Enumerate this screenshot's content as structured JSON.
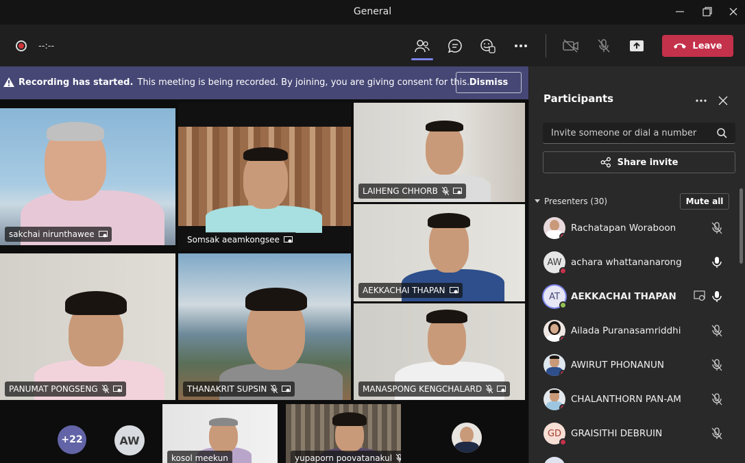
{
  "window": {
    "title": "General"
  },
  "toolbar": {
    "timer": "--:--",
    "leave_label": "Leave"
  },
  "banner": {
    "title": "Recording has started.",
    "message": "This meeting is being recorded. By joining, you are giving consent for this...",
    "dismiss_label": "Dismiss"
  },
  "tiles": [
    {
      "name": "sakchai nirunthawee"
    },
    {
      "name": "Somsak aeamkongsee"
    },
    {
      "name": "LAIHENG CHHORB"
    },
    {
      "name": "AEKKACHAI THAPAN"
    },
    {
      "name": "PANUMAT PONGSENG"
    },
    {
      "name": "THANAKRIT SUPSIN"
    },
    {
      "name": "MANASPONG KENGCHALARD"
    }
  ],
  "bottom": {
    "more_count": "+22",
    "aw_initials": "AW",
    "small_tiles": [
      {
        "name": "kosol meekun"
      },
      {
        "name": "yupaporn poovatanakul"
      }
    ]
  },
  "panel": {
    "title": "Participants",
    "search_placeholder": "Invite someone or dial a number",
    "share_label": "Share invite",
    "section_label": "Presenters (30)",
    "mute_all_label": "Mute all",
    "participants": [
      {
        "name": "Rachatapan Woraboon",
        "initials": "",
        "mic": "muted"
      },
      {
        "name": "achara whattananarong",
        "initials": "AW",
        "mic": "on"
      },
      {
        "name": "AEKKACHAI THAPAN",
        "initials": "AT",
        "mic": "on"
      },
      {
        "name": "Ailada Puranasamriddhi",
        "initials": "",
        "mic": "muted"
      },
      {
        "name": "AWIRUT PHONANUN",
        "initials": "",
        "mic": "muted"
      },
      {
        "name": "CHALANTHORN PAN-AM",
        "initials": "",
        "mic": "muted"
      },
      {
        "name": "GRAISITHI DEBRUIN",
        "initials": "GD",
        "mic": "muted"
      }
    ]
  },
  "colors": {
    "accent": "#6264a7",
    "leave": "#c4314b",
    "banner": "#464775",
    "busy": "#c4314b",
    "available": "#92c353"
  }
}
